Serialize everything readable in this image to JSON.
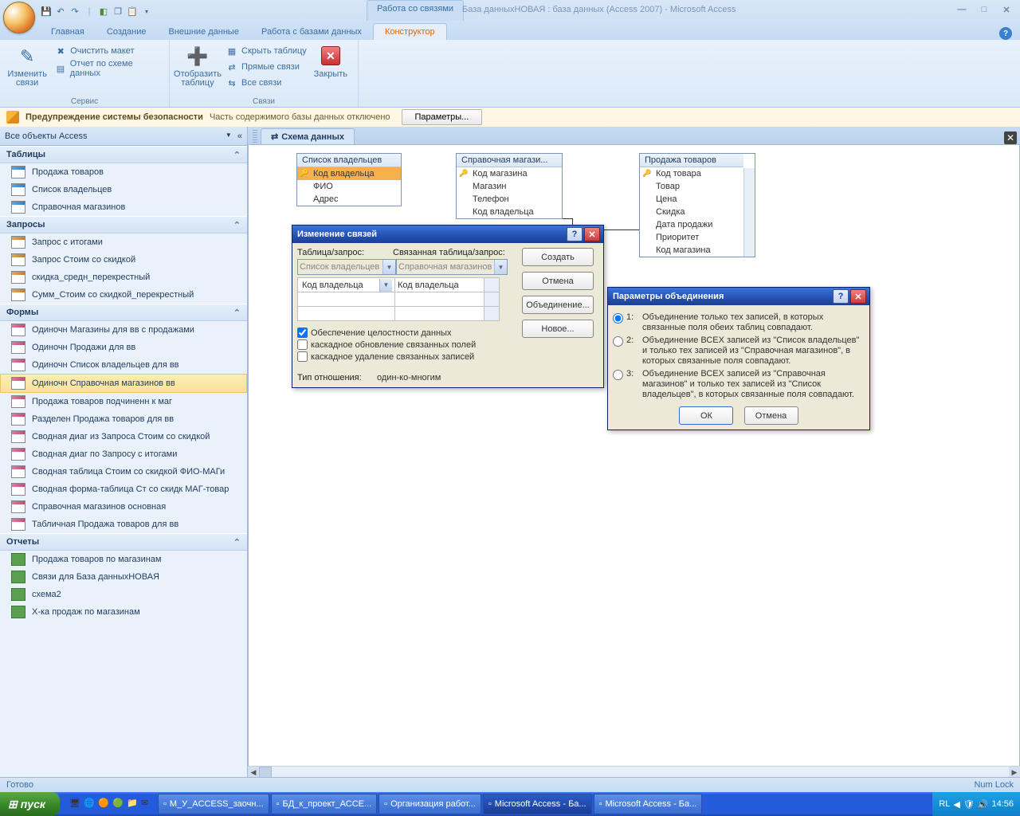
{
  "title": {
    "context_tab": "Работа со связями",
    "doc_title": "База данныхНОВАЯ : база данных (Access 2007) - Microsoft Access"
  },
  "ribbon": {
    "tabs": [
      "Главная",
      "Создание",
      "Внешние данные",
      "Работа с базами данных",
      "Конструктор"
    ],
    "active_tab": "Конструктор",
    "groups": {
      "service": {
        "label": "Сервис",
        "edit_rel": "Изменить связи",
        "clear_layout": "Очистить макет",
        "rel_report": "Отчет по схеме данных"
      },
      "relations": {
        "label": "Связи",
        "show_table": "Отобразить таблицу",
        "hide_table": "Скрыть таблицу",
        "direct_rel": "Прямые связи",
        "all_rel": "Все связи",
        "close": "Закрыть"
      }
    }
  },
  "msgbar": {
    "title": "Предупреждение системы безопасности",
    "text": "Часть содержимого базы данных отключено",
    "button": "Параметры..."
  },
  "nav": {
    "header": "Все объекты Access",
    "tables": {
      "label": "Таблицы",
      "items": [
        "Продажа товаров",
        "Список владельцев",
        "Справочная магазинов"
      ]
    },
    "queries": {
      "label": "Запросы",
      "items": [
        "Запрос с итогами",
        "Запрос Стоим со скидкой",
        "скидка_средн_перекрестный",
        "Сумм_Стоим со скидкой_перекрестный"
      ]
    },
    "forms": {
      "label": "Формы",
      "items": [
        "Одиночн Магазины для вв с продажами",
        "Одиночн Продажи для вв",
        "Одиночн Список владельцев для вв",
        "Одиночн Справочная магазинов вв",
        "Продажа товаров подчиненн к маг",
        "Разделен Продажа товаров для вв",
        "Сводная диаг из Запроса Стоим со скидкой",
        "Сводная диаг по Запросу с итогами",
        "Сводная таблица Стоим со скидкой ФИО-МАГи",
        "Сводная форма-таблица Ст со скидк МАГ-товар",
        "Справочная магазинов основная",
        "Табличная Продажа товаров для вв"
      ],
      "selected": 3
    },
    "reports": {
      "label": "Отчеты",
      "items": [
        "Продажа товаров по магазинам",
        "Связи для База данныхНОВАЯ",
        "схема2",
        "Х-ка продаж по магазинам"
      ]
    }
  },
  "doc_tab": "Схема данных",
  "diagram": {
    "t1": {
      "title": "Список владельцев",
      "fields": [
        "Код владельца",
        "ФИО",
        "Адрес"
      ],
      "key": 0,
      "sel": 0
    },
    "t2": {
      "title": "Справочная магази...",
      "fields": [
        "Код магазина",
        "Магазин",
        "Телефон",
        "Код владельца"
      ],
      "key": 0
    },
    "t3": {
      "title": "Продажа товаров",
      "fields": [
        "Код товара",
        "Товар",
        "Цена",
        "Скидка",
        "Дата продажи",
        "Приоритет",
        "Код магазина"
      ],
      "key": 0
    }
  },
  "dlg_edit": {
    "title": "Изменение связей",
    "lbl_table": "Таблица/запрос:",
    "lbl_rel_table": "Связанная таблица/запрос:",
    "combo_left": "Список владельцев",
    "combo_right": "Справочная магазинов",
    "fld_left": "Код владельца",
    "fld_right": "Код владельца",
    "chk1": "Обеспечение целостности данных",
    "chk2": "каскадное обновление связанных полей",
    "chk3": "каскадное удаление связанных записей",
    "lbl_type": "Тип отношения:",
    "val_type": "один-ко-многим",
    "btn_create": "Создать",
    "btn_cancel": "Отмена",
    "btn_join": "Объединение...",
    "btn_new": "Новое..."
  },
  "dlg_join": {
    "title": "Параметры объединения",
    "opt1_num": "1:",
    "opt1": "Объединение только тех записей, в которых связанные поля обеих таблиц совпадают.",
    "opt2_num": "2:",
    "opt2": "Объединение ВСЕХ записей из \"Список владельцев\" и только тех записей из \"Справочная магазинов\", в которых связанные поля совпадают.",
    "opt3_num": "3:",
    "opt3": "Объединение ВСЕХ записей из \"Справочная магазинов\" и только тех записей из \"Список владельцев\", в которых связанные поля совпадают.",
    "btn_ok": "ОК",
    "btn_cancel": "Отмена"
  },
  "status": {
    "left": "Готово",
    "right": "Num Lock"
  },
  "taskbar": {
    "start": "пуск",
    "buttons": [
      "М_У_ACCESS_заочн...",
      "БД_к_проект_АССЕ...",
      "Организация работ...",
      "Microsoft Access - Ба...",
      "Microsoft Access - Ба..."
    ],
    "active": 3,
    "lang": "RL",
    "time": "14:56"
  }
}
